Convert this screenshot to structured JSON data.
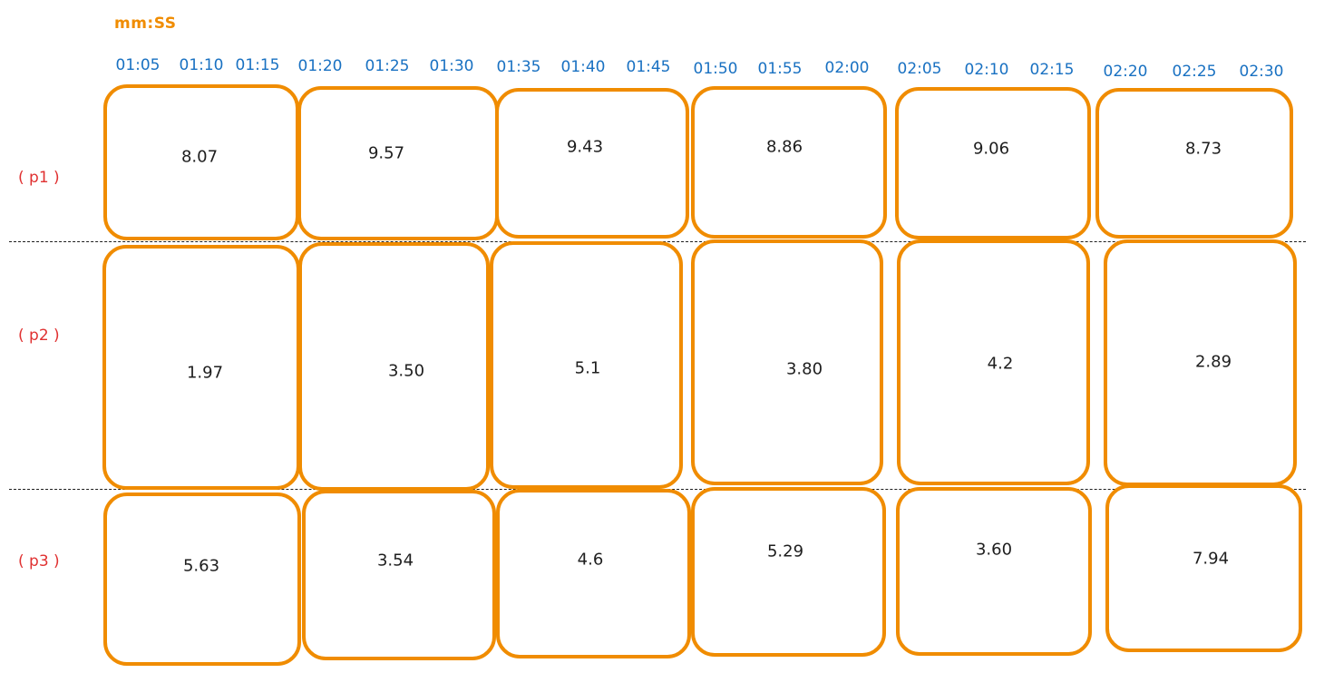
{
  "axis_unit": "mm:SS",
  "time_ticks": [
    "01:05",
    "01:10",
    "01:15",
    "01:20",
    "01:25",
    "01:30",
    "01:35",
    "01:40",
    "01:45",
    "01:50",
    "01:55",
    "02:00",
    "02:05",
    "02:10",
    "02:15",
    "02:20",
    "02:25",
    "02:30"
  ],
  "rows": [
    {
      "label": "( p1 )",
      "values": [
        "8.07",
        "9.57",
        "9.43",
        "8.86",
        "9.06",
        "8.73"
      ]
    },
    {
      "label": "( p2 )",
      "values": [
        "1.97",
        "3.50",
        "5.1",
        "3.80",
        "4.2",
        "2.89"
      ]
    },
    {
      "label": "( p3 )",
      "values": [
        "5.63",
        "3.54",
        "4.6",
        "5.29",
        "3.60",
        "7.94"
      ]
    }
  ],
  "colors": {
    "box_stroke": "#f08c00",
    "axis_unit": "#f08c00",
    "time_ticks": "#1971c2",
    "row_labels": "#e03131",
    "values": "#1e1e1e",
    "divider": "#1e1e1e"
  }
}
